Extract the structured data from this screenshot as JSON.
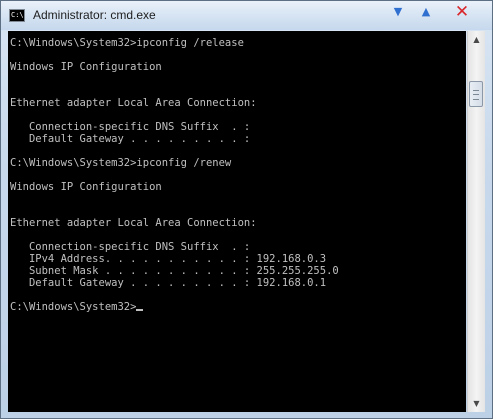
{
  "window": {
    "title": "Administrator: cmd.exe",
    "app_icon_text": "C:\\",
    "controls": {
      "minimize_glyph": "▼",
      "maximize_glyph": "▲",
      "close_glyph": "✕"
    }
  },
  "console": {
    "text_color": "#c0c0c0",
    "background": "#000000",
    "lines": [
      "C:\\Windows\\System32>ipconfig /release",
      "",
      "Windows IP Configuration",
      "",
      "",
      "Ethernet adapter Local Area Connection:",
      "",
      "   Connection-specific DNS Suffix  . :",
      "   Default Gateway . . . . . . . . . :",
      "",
      "C:\\Windows\\System32>ipconfig /renew",
      "",
      "Windows IP Configuration",
      "",
      "",
      "Ethernet adapter Local Area Connection:",
      "",
      "   Connection-specific DNS Suffix  . :",
      "   IPv4 Address. . . . . . . . . . . : 192.168.0.3",
      "   Subnet Mask . . . . . . . . . . . : 255.255.255.0",
      "   Default Gateway . . . . . . . . . : 192.168.0.1",
      "",
      "C:\\Windows\\System32>"
    ]
  },
  "scrollbar": {
    "up_glyph": "▲",
    "down_glyph": "▼",
    "position_fraction": 0.0
  }
}
